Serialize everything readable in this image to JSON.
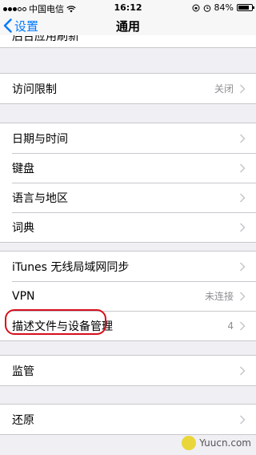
{
  "status_bar": {
    "carrier": "中国电信",
    "time": "16:12",
    "battery": "84%",
    "battery_level": 0.84,
    "signal_bars": 3,
    "signal_total": 5
  },
  "nav": {
    "back_label": "设置",
    "title": "通用"
  },
  "partial_row_label": "后台应用刷新",
  "groups": [
    {
      "rows": [
        {
          "label": "访问限制",
          "value": "关闭"
        }
      ]
    },
    {
      "rows": [
        {
          "label": "日期与时间",
          "value": ""
        },
        {
          "label": "键盘",
          "value": ""
        },
        {
          "label": "语言与地区",
          "value": ""
        },
        {
          "label": "词典",
          "value": ""
        }
      ]
    },
    {
      "rows": [
        {
          "label": "iTunes 无线局域网同步",
          "value": ""
        },
        {
          "label": "VPN",
          "value": "未连接"
        },
        {
          "label": "描述文件与设备管理",
          "value": "4"
        }
      ]
    },
    {
      "rows": [
        {
          "label": "监管",
          "value": ""
        }
      ]
    },
    {
      "rows": [
        {
          "label": "还原",
          "value": ""
        }
      ]
    }
  ],
  "watermark": "Yuucn.com",
  "colors": {
    "accent": "#007aff",
    "highlight": "#d60f1d",
    "background": "#efeff4",
    "separator": "#c8c7cc",
    "secondary_text": "#8e8e93"
  }
}
